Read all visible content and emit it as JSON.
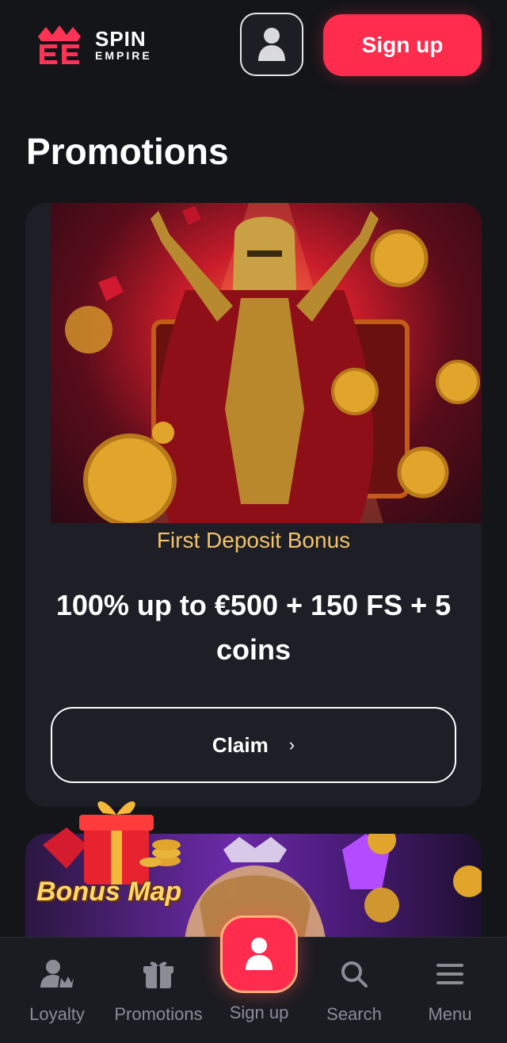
{
  "brand": {
    "name_top": "SPIN",
    "name_bottom": "EMPIRE",
    "accent": "#ff2c4e",
    "gold": "#f2c36b"
  },
  "header": {
    "profile_icon": "user-icon",
    "signup_label": "Sign up"
  },
  "page": {
    "title": "Promotions"
  },
  "promo": {
    "subtitle": "First Deposit Bonus",
    "title": "100% up to €500 + 150 FS + 5 coins",
    "claim_label": "Claim",
    "claim_icon": "chevron-right-icon"
  },
  "promo2": {
    "label": "Bonus Map"
  },
  "bottom_nav": {
    "items": [
      {
        "label": "Loyalty",
        "icon": "loyalty-icon"
      },
      {
        "label": "Promotions",
        "icon": "gift-icon"
      },
      {
        "label": "Sign up",
        "icon": "user-icon"
      },
      {
        "label": "Search",
        "icon": "search-icon"
      },
      {
        "label": "Menu",
        "icon": "menu-icon"
      }
    ]
  }
}
